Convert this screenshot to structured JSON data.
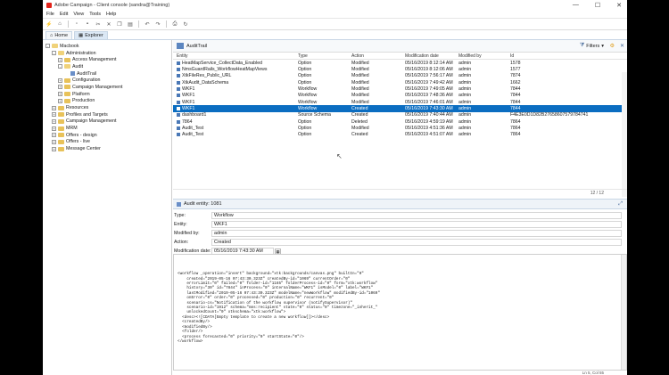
{
  "window": {
    "title": "Adobe Campaign - Client console (sandra@Training)",
    "controls": {
      "minimize": "—",
      "maximize": "☐",
      "close": "✕"
    }
  },
  "menu": [
    "File",
    "Edit",
    "View",
    "Tools",
    "Help"
  ],
  "tabs": [
    {
      "label": "Home"
    },
    {
      "label": "Explorer"
    }
  ],
  "tree": [
    {
      "label": "Macbook",
      "indent": 0,
      "exp": "-",
      "icon": "root"
    },
    {
      "label": "Administration",
      "indent": 1,
      "exp": "-",
      "icon": "folder-open"
    },
    {
      "label": "Access Management",
      "indent": 2,
      "exp": "+",
      "icon": "folder"
    },
    {
      "label": "Audit",
      "indent": 2,
      "exp": "-",
      "icon": "folder-open"
    },
    {
      "label": "AuditTrail",
      "indent": 3,
      "exp": "",
      "icon": "leaf"
    },
    {
      "label": "Configuration",
      "indent": 2,
      "exp": "+",
      "icon": "folder"
    },
    {
      "label": "Campaign Management",
      "indent": 2,
      "exp": "+",
      "icon": "folder"
    },
    {
      "label": "Platform",
      "indent": 2,
      "exp": "+",
      "icon": "folder"
    },
    {
      "label": "Production",
      "indent": 2,
      "exp": "+",
      "icon": "folder"
    },
    {
      "label": "Resources",
      "indent": 1,
      "exp": "+",
      "icon": "folder"
    },
    {
      "label": "Profiles and Targets",
      "indent": 1,
      "exp": "+",
      "icon": "folder"
    },
    {
      "label": "Campaign Management",
      "indent": 1,
      "exp": "+",
      "icon": "folder"
    },
    {
      "label": "MRM",
      "indent": 1,
      "exp": "+",
      "icon": "folder"
    },
    {
      "label": "Offers - design",
      "indent": 1,
      "exp": "+",
      "icon": "folder"
    },
    {
      "label": "Offers - live",
      "indent": 1,
      "exp": "+",
      "icon": "folder"
    },
    {
      "label": "Message Center",
      "indent": 1,
      "exp": "+",
      "icon": "folder"
    }
  ],
  "list": {
    "title": "AuditTrail",
    "filters_label": "Filters",
    "columns": {
      "entity": "Entity",
      "type": "Type",
      "action": "Action",
      "date": "Modification date",
      "modified_by": "Modified by",
      "id": "Id"
    },
    "rows": [
      {
        "entity": "HeatMapService_CollectData_Enabled",
        "type": "Option",
        "action": "Modified",
        "date": "05/16/2019 8:12:14 AM",
        "modified_by": "admin",
        "id": "1578",
        "selected": false
      },
      {
        "entity": "NmsGuardRails_WorkflowHeatMapViews",
        "type": "Option",
        "action": "Modified",
        "date": "05/16/2019 8:12:06 AM",
        "modified_by": "admin",
        "id": "1577",
        "selected": false
      },
      {
        "entity": "XtkFileRes_Public_URL",
        "type": "Option",
        "action": "Modified",
        "date": "05/16/2019 7:56:17 AM",
        "modified_by": "admin",
        "id": "7874",
        "selected": false
      },
      {
        "entity": "XtkAudit_DataSchema",
        "type": "Option",
        "action": "Modified",
        "date": "05/16/2019 7:49:42 AM",
        "modified_by": "admin",
        "id": "1662",
        "selected": false
      },
      {
        "entity": "WKF1",
        "type": "Workflow",
        "action": "Modified",
        "date": "05/16/2019 7:49:05 AM",
        "modified_by": "admin",
        "id": "7844",
        "selected": false
      },
      {
        "entity": "WKF1",
        "type": "Workflow",
        "action": "Modified",
        "date": "05/16/2019 7:48:36 AM",
        "modified_by": "admin",
        "id": "7844",
        "selected": false
      },
      {
        "entity": "WKF1",
        "type": "Workflow",
        "action": "Modified",
        "date": "05/16/2019 7:46:01 AM",
        "modified_by": "admin",
        "id": "7844",
        "selected": false
      },
      {
        "entity": "WKF1",
        "type": "Workflow",
        "action": "Created",
        "date": "05/16/2019 7:43:30 AM",
        "modified_by": "admin",
        "id": "7844",
        "selected": true
      },
      {
        "entity": "dashboard1",
        "type": "Source Schema",
        "action": "Created",
        "date": "05/16/2019 7:40:44 AM",
        "modified_by": "admin",
        "id": "F4E3E0D1D82B27658607579784741",
        "selected": false
      },
      {
        "entity": "7864",
        "type": "Option",
        "action": "Deleted",
        "date": "05/16/2019 4:59:19 AM",
        "modified_by": "admin",
        "id": "7864",
        "selected": false
      },
      {
        "entity": "Audit_Test",
        "type": "Option",
        "action": "Modified",
        "date": "05/16/2019 4:51:36 AM",
        "modified_by": "admin",
        "id": "7864",
        "selected": false
      },
      {
        "entity": "Audit_Test",
        "type": "Option",
        "action": "Created",
        "date": "05/16/2019 4:51:07 AM",
        "modified_by": "admin",
        "id": "7864",
        "selected": false
      }
    ],
    "counter": "12 / 12"
  },
  "detail": {
    "title": "Audit entity: 1081",
    "fields": [
      {
        "label": "Type:",
        "value": "Workflow",
        "width": "full"
      },
      {
        "label": "Entity:",
        "value": "WKF1",
        "width": "full"
      },
      {
        "label": "Modified by:",
        "value": "admin",
        "width": "full"
      },
      {
        "label": "Action:",
        "value": "Created",
        "width": "full"
      },
      {
        "label": "Modification date:",
        "value": "05/16/2019 7:43:30 AM",
        "width": "date"
      }
    ],
    "xml_lines": [
      "<workflow _operation=\"insert\" background=\"xtk:backgrounds/canvas.png\" builtIn=\"0\"",
      "    created=\"2019-05-16 07:43:30.323Z\" createdBy-id=\"1069\" currentOrder=\"0\"",
      "    errorLimit=\"0\" failed=\"0\" folder-id=\"1165\" folderProcess-id=\"0\" form=\"xtk:workflow\"",
      "    history=\"30\" id=\"7844\" inProcess=\"0\" internalName=\"WKF1\" isModel=\"0\" label=\"WKF1\"",
      "    lastModified=\"2019-05-16 07:43:30.323Z\" modelName=\"newWorkflow\" modifiedBy-id=\"1069\"",
      "    onError=\"0\" order=\"0\" processed=\"0\" production=\"0\" recurrent=\"0\"",
      "    scenario-cs=\"Notification of the workflow supervisor (notifySupervisor)\"",
      "    scenario-id=\"1912\" schema=\"nms:recipient\" state=\"0\" status=\"0\" timezone=\"_inherit_\"",
      "    unlockedCount=\"0\" xtkschema=\"xtk:workflow\">",
      "  <desc><![CDATA[Empty template to create a new workflow]]></desc>",
      "  <createdBy/>",
      "  <modifiedBy/>",
      "  <folder/>",
      "  <process forecasted=\"0\" priority=\"0\" startState=\"0\"/>",
      "</workflow>"
    ]
  },
  "status": "Ln 5, Col 55"
}
